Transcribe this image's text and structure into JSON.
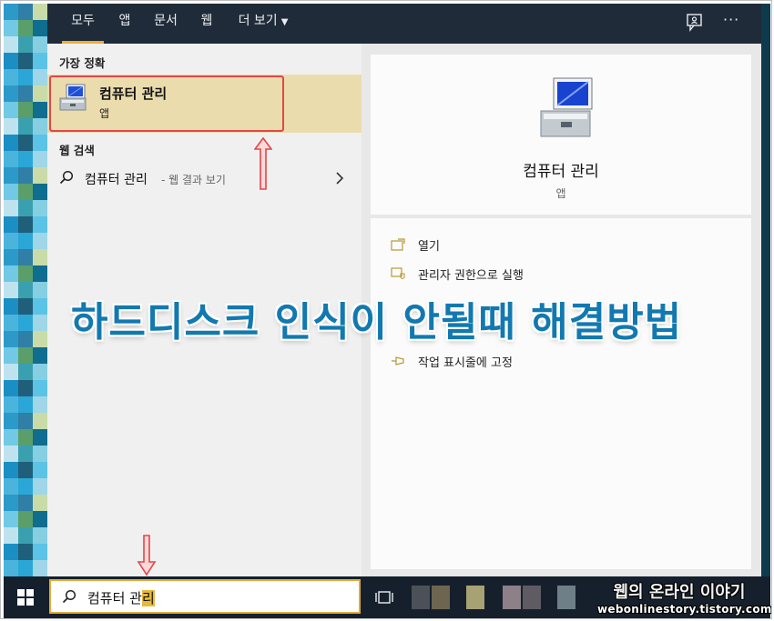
{
  "tabs": [
    {
      "label": "모두",
      "active": true
    },
    {
      "label": "앱"
    },
    {
      "label": "문서"
    },
    {
      "label": "웹"
    },
    {
      "label": "더 보기",
      "dropdown": true
    }
  ],
  "top_icons": [
    "feedback-icon",
    "more-icon"
  ],
  "more_glyph": "···",
  "left_panel": {
    "best_match_heading": "가장 정확",
    "best_match": {
      "title": "컴퓨터 관리",
      "subtitle": "앱",
      "icon": "computer-management-icon"
    },
    "web_heading": "웹 검색",
    "web_result": {
      "query": "컴퓨터 관리",
      "hint": "- 웹 결과 보기",
      "icon": "search-icon"
    }
  },
  "right_panel": {
    "title": "컴퓨터 관리",
    "type": "앱",
    "actions": [
      {
        "label": "열기",
        "icon": "open-icon"
      },
      {
        "label": "관리자 권한으로 실행",
        "icon": "admin-shield-icon"
      },
      {
        "label": "",
        "icon": ""
      },
      {
        "label": "",
        "icon": ""
      },
      {
        "label": "작업 표시줄에 고정",
        "icon": "pin-taskbar-icon"
      }
    ]
  },
  "overlay_title": "하드디스크 인식이 안될때 해결방법",
  "taskbar": {
    "search_text": "컴퓨터 관",
    "search_highlight": "리",
    "brand_name": "웹의 온라인 이야기",
    "brand_url": "webonlinestory.tistory.com"
  },
  "colors": {
    "topbar": "#1f2b38",
    "accent": "#f0ad3b",
    "best_match_bg": "#ebdcae",
    "highlight_border": "#e0474a",
    "overlay_text": "#1279b0",
    "taskbar": "#16202c"
  }
}
